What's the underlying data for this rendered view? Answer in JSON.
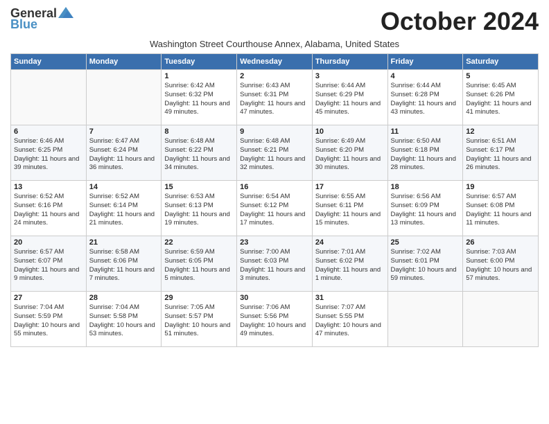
{
  "header": {
    "logo_general": "General",
    "logo_blue": "Blue",
    "month_title": "October 2024",
    "subtitle": "Washington Street Courthouse Annex, Alabama, United States"
  },
  "weekdays": [
    "Sunday",
    "Monday",
    "Tuesday",
    "Wednesday",
    "Thursday",
    "Friday",
    "Saturday"
  ],
  "weeks": [
    [
      {
        "day": "",
        "detail": ""
      },
      {
        "day": "",
        "detail": ""
      },
      {
        "day": "1",
        "detail": "Sunrise: 6:42 AM\nSunset: 6:32 PM\nDaylight: 11 hours and 49 minutes."
      },
      {
        "day": "2",
        "detail": "Sunrise: 6:43 AM\nSunset: 6:31 PM\nDaylight: 11 hours and 47 minutes."
      },
      {
        "day": "3",
        "detail": "Sunrise: 6:44 AM\nSunset: 6:29 PM\nDaylight: 11 hours and 45 minutes."
      },
      {
        "day": "4",
        "detail": "Sunrise: 6:44 AM\nSunset: 6:28 PM\nDaylight: 11 hours and 43 minutes."
      },
      {
        "day": "5",
        "detail": "Sunrise: 6:45 AM\nSunset: 6:26 PM\nDaylight: 11 hours and 41 minutes."
      }
    ],
    [
      {
        "day": "6",
        "detail": "Sunrise: 6:46 AM\nSunset: 6:25 PM\nDaylight: 11 hours and 39 minutes."
      },
      {
        "day": "7",
        "detail": "Sunrise: 6:47 AM\nSunset: 6:24 PM\nDaylight: 11 hours and 36 minutes."
      },
      {
        "day": "8",
        "detail": "Sunrise: 6:48 AM\nSunset: 6:22 PM\nDaylight: 11 hours and 34 minutes."
      },
      {
        "day": "9",
        "detail": "Sunrise: 6:48 AM\nSunset: 6:21 PM\nDaylight: 11 hours and 32 minutes."
      },
      {
        "day": "10",
        "detail": "Sunrise: 6:49 AM\nSunset: 6:20 PM\nDaylight: 11 hours and 30 minutes."
      },
      {
        "day": "11",
        "detail": "Sunrise: 6:50 AM\nSunset: 6:18 PM\nDaylight: 11 hours and 28 minutes."
      },
      {
        "day": "12",
        "detail": "Sunrise: 6:51 AM\nSunset: 6:17 PM\nDaylight: 11 hours and 26 minutes."
      }
    ],
    [
      {
        "day": "13",
        "detail": "Sunrise: 6:52 AM\nSunset: 6:16 PM\nDaylight: 11 hours and 24 minutes."
      },
      {
        "day": "14",
        "detail": "Sunrise: 6:52 AM\nSunset: 6:14 PM\nDaylight: 11 hours and 21 minutes."
      },
      {
        "day": "15",
        "detail": "Sunrise: 6:53 AM\nSunset: 6:13 PM\nDaylight: 11 hours and 19 minutes."
      },
      {
        "day": "16",
        "detail": "Sunrise: 6:54 AM\nSunset: 6:12 PM\nDaylight: 11 hours and 17 minutes."
      },
      {
        "day": "17",
        "detail": "Sunrise: 6:55 AM\nSunset: 6:11 PM\nDaylight: 11 hours and 15 minutes."
      },
      {
        "day": "18",
        "detail": "Sunrise: 6:56 AM\nSunset: 6:09 PM\nDaylight: 11 hours and 13 minutes."
      },
      {
        "day": "19",
        "detail": "Sunrise: 6:57 AM\nSunset: 6:08 PM\nDaylight: 11 hours and 11 minutes."
      }
    ],
    [
      {
        "day": "20",
        "detail": "Sunrise: 6:57 AM\nSunset: 6:07 PM\nDaylight: 11 hours and 9 minutes."
      },
      {
        "day": "21",
        "detail": "Sunrise: 6:58 AM\nSunset: 6:06 PM\nDaylight: 11 hours and 7 minutes."
      },
      {
        "day": "22",
        "detail": "Sunrise: 6:59 AM\nSunset: 6:05 PM\nDaylight: 11 hours and 5 minutes."
      },
      {
        "day": "23",
        "detail": "Sunrise: 7:00 AM\nSunset: 6:03 PM\nDaylight: 11 hours and 3 minutes."
      },
      {
        "day": "24",
        "detail": "Sunrise: 7:01 AM\nSunset: 6:02 PM\nDaylight: 11 hours and 1 minute."
      },
      {
        "day": "25",
        "detail": "Sunrise: 7:02 AM\nSunset: 6:01 PM\nDaylight: 10 hours and 59 minutes."
      },
      {
        "day": "26",
        "detail": "Sunrise: 7:03 AM\nSunset: 6:00 PM\nDaylight: 10 hours and 57 minutes."
      }
    ],
    [
      {
        "day": "27",
        "detail": "Sunrise: 7:04 AM\nSunset: 5:59 PM\nDaylight: 10 hours and 55 minutes."
      },
      {
        "day": "28",
        "detail": "Sunrise: 7:04 AM\nSunset: 5:58 PM\nDaylight: 10 hours and 53 minutes."
      },
      {
        "day": "29",
        "detail": "Sunrise: 7:05 AM\nSunset: 5:57 PM\nDaylight: 10 hours and 51 minutes."
      },
      {
        "day": "30",
        "detail": "Sunrise: 7:06 AM\nSunset: 5:56 PM\nDaylight: 10 hours and 49 minutes."
      },
      {
        "day": "31",
        "detail": "Sunrise: 7:07 AM\nSunset: 5:55 PM\nDaylight: 10 hours and 47 minutes."
      },
      {
        "day": "",
        "detail": ""
      },
      {
        "day": "",
        "detail": ""
      }
    ]
  ]
}
